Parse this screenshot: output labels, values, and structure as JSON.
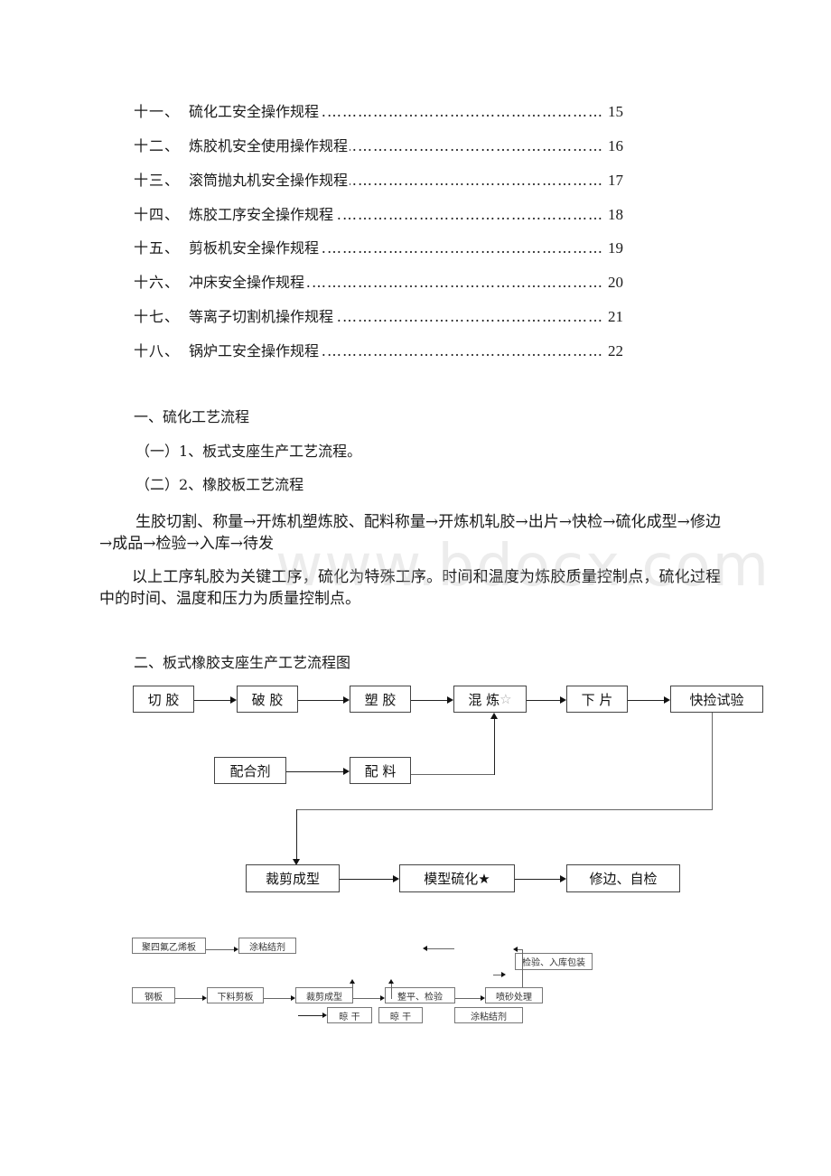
{
  "toc": [
    {
      "num": "十一、",
      "title": "硫化工安全操作规程",
      "page": "15"
    },
    {
      "num": "十二、",
      "title": "炼胶机安全使用操作规程",
      "page": "16"
    },
    {
      "num": "十三、",
      "title": "滚筒抛丸机安全操作规程",
      "page": "17"
    },
    {
      "num": "十四、",
      "title": "炼胶工序安全操作规程",
      "page": "18"
    },
    {
      "num": "十五、",
      "title": "剪板机安全操作规程",
      "page": "19"
    },
    {
      "num": "十六、",
      "title": "冲床安全操作规程",
      "page": "20"
    },
    {
      "num": "十七、",
      "title": "等离子切割机操作规程",
      "page": "21"
    },
    {
      "num": "十八、",
      "title": "锅炉工安全操作规程",
      "page": "22"
    }
  ],
  "toc_dots": "…………………………………………………………………………………",
  "section1": {
    "heading": "一、硫化工艺流程",
    "sub1": "（一）1、板式支座生产工艺流程。",
    "sub2": "（二）2、橡胶板工艺流程",
    "flow_text": "生胶切割、称量→开炼机塑炼胶、配料称量→开炼机轧胶→出片→快检→硫化成型→修边→成品→检验→入库→待发",
    "note_text": "以上工序轧胶为关键工序，硫化为特殊工序。时间和温度为炼胶质量控制点，硫化过程中的时间、温度和压力为质量控制点。"
  },
  "watermark": "www.bdocx.com",
  "section2": {
    "heading": "二、板式橡胶支座生产工艺流程图",
    "row1": [
      "切 胶",
      "破 胶",
      "塑 胶",
      "混 炼",
      "下 片",
      "快捡试验"
    ],
    "mix_star": "☆",
    "row2": [
      "配合剂",
      "配 料"
    ],
    "row3": [
      "裁剪成型",
      "模型硫化★",
      "修边、自检"
    ]
  },
  "diagram2": {
    "ptfe": "聚四氟乙烯板",
    "glue_top": "涂粘结剂",
    "inspect_pack": "检验、入库包装",
    "steel": "钢板",
    "cut": "下料剪板",
    "shape": "裁剪成型",
    "level": "整平、检验",
    "blast": "喷砂处理",
    "dry1": "晾 干",
    "dry2": "晾  干",
    "glue_bottom": "涂粘结剂"
  }
}
